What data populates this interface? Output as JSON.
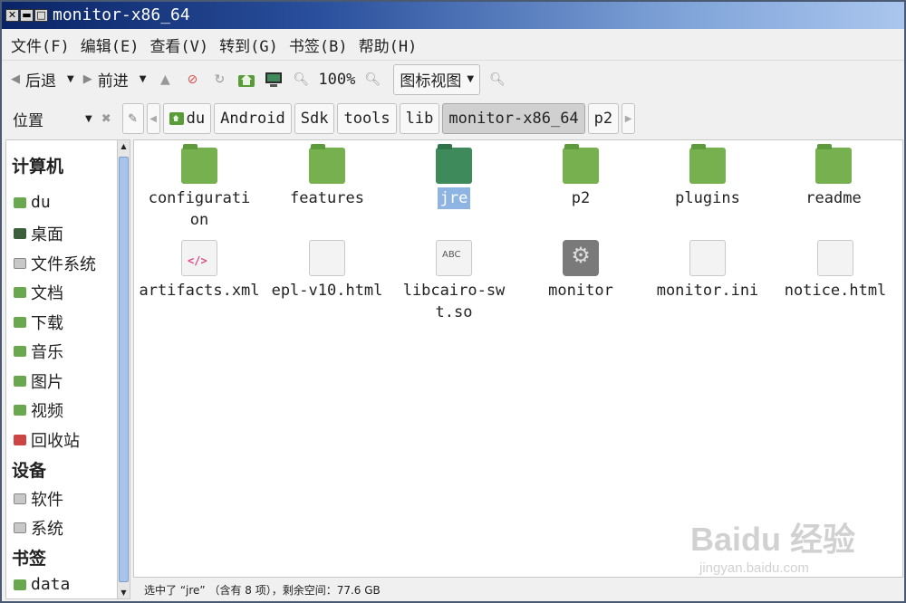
{
  "window": {
    "title": "monitor-x86_64"
  },
  "menu": [
    "文件(F)",
    "编辑(E)",
    "查看(V)",
    "转到(G)",
    "书签(B)",
    "帮助(H)"
  ],
  "toolbar": {
    "back_label": "后退",
    "forward_label": "前进",
    "zoom": "100%",
    "view_mode": "图标视图"
  },
  "location": {
    "label": "位置",
    "crumbs": [
      "du",
      "Android",
      "Sdk",
      "tools",
      "lib",
      "monitor-x86_64",
      "p2"
    ],
    "active_crumb": "monitor-x86_64"
  },
  "sidebar": {
    "computer_heading": "计算机",
    "computer_items": [
      "du",
      "桌面",
      "文件系统",
      "文档",
      "下载",
      "音乐",
      "图片",
      "视频",
      "回收站"
    ],
    "devices_heading": "设备",
    "device_items": [
      "软件",
      "系统"
    ],
    "bookmarks_heading": "书签",
    "bookmark_items": [
      "data"
    ]
  },
  "files": [
    {
      "name": "configuration",
      "kind": "folder-icon"
    },
    {
      "name": "features",
      "kind": "folder-icon"
    },
    {
      "name": "jre",
      "kind": "folder-icon",
      "selected": true
    },
    {
      "name": "p2",
      "kind": "folder-icon"
    },
    {
      "name": "plugins",
      "kind": "folder-icon"
    },
    {
      "name": "readme",
      "kind": "folder-icon"
    },
    {
      "name": "artifacts.xml",
      "kind": "xml-file-icon"
    },
    {
      "name": "epl-v10.html",
      "kind": "html-file-icon"
    },
    {
      "name": "libcairo-swt.so",
      "kind": "library-file-icon"
    },
    {
      "name": "monitor",
      "kind": "executable-icon"
    },
    {
      "name": "monitor.ini",
      "kind": "text-file-icon"
    },
    {
      "name": "notice.html",
      "kind": "html-file-icon"
    }
  ],
  "status": "选中了 “jre” （含有 8 项），剩余空间：77.6 GB",
  "watermark": {
    "logo": "Baidu 经验",
    "url": "jingyan.baidu.com"
  },
  "colors": {
    "folder": "#76b04f",
    "selection": "#8eb4e3",
    "titlebar": "#0a2466"
  }
}
